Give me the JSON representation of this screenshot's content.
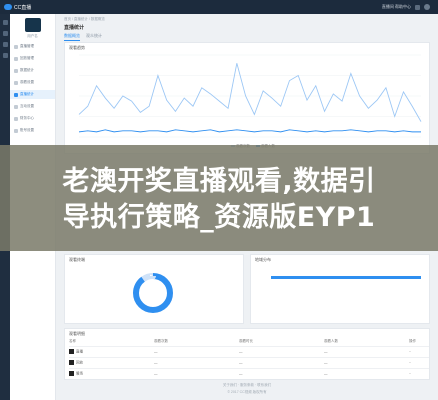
{
  "app": {
    "logo_text": "CC直播",
    "user_name": "用户名"
  },
  "topbar": {
    "right_text": "直播间 帮助中心"
  },
  "sidebar": {
    "items": [
      {
        "label": "直播管理",
        "active": false
      },
      {
        "label": "回放管理",
        "active": false
      },
      {
        "label": "数据统计",
        "active": false
      },
      {
        "label": "观看设置",
        "active": false
      },
      {
        "label": "直播统计",
        "active": true
      },
      {
        "label": "互动设置",
        "active": false
      },
      {
        "label": "财务中心",
        "active": false
      },
      {
        "label": "账号设置",
        "active": false
      }
    ]
  },
  "main": {
    "breadcrumb": "首页 / 直播统计 / 数据概览",
    "title": "直播统计",
    "tabs": [
      "数据概览",
      "观众统计"
    ],
    "trend_card_title": "观看趋势",
    "pie_card_title": "观看终端",
    "bar_card_title": "地域分布",
    "table_card_title": "观看明细",
    "table_headers": [
      "名称",
      "观看次数",
      "观看时长",
      "观看人数",
      "操作"
    ],
    "table_rows": [
      [
        "直播",
        "—",
        "—",
        "—",
        "··"
      ],
      [
        "回放",
        "—",
        "—",
        "—",
        "··"
      ],
      [
        "暖场",
        "—",
        "—",
        "—",
        "··"
      ]
    ],
    "legend": [
      "观看次数",
      "观看人数"
    ],
    "footer_line1": "关于我们 · 服务条款 · 联系我们",
    "footer_line2": "© 2017 CC视频 版权所有"
  },
  "banner": {
    "line1": "老澳开奖直播观看,数据引",
    "line2": "导执行策略_资源版EYP1"
  },
  "chart_data": {
    "type": "line",
    "x": [
      1,
      2,
      3,
      4,
      5,
      6,
      7,
      8,
      9,
      10,
      11,
      12,
      13,
      14,
      15,
      16,
      17,
      18,
      19,
      20,
      21,
      22,
      23,
      24,
      25,
      26,
      27,
      28,
      29,
      30,
      31,
      32,
      33,
      34,
      35,
      36,
      37,
      38,
      39,
      40
    ],
    "series": [
      {
        "values": [
          22,
          30,
          50,
          38,
          28,
          40,
          35,
          24,
          30,
          60,
          36,
          25,
          38,
          30,
          48,
          42,
          35,
          28,
          72,
          40,
          22,
          45,
          38,
          30,
          55,
          60,
          36,
          50,
          25,
          42,
          35,
          62,
          40,
          28,
          36,
          48,
          20,
          44,
          30,
          15
        ]
      },
      {
        "values": [
          5,
          6,
          5,
          7,
          5,
          6,
          6,
          5,
          6,
          6,
          5,
          7,
          6,
          5,
          6,
          7,
          5,
          6,
          7,
          6,
          5,
          6,
          6,
          5,
          7,
          6,
          5,
          6,
          5,
          6,
          6,
          7,
          6,
          5,
          6,
          6,
          5,
          6,
          5,
          5
        ]
      }
    ],
    "ylim": [
      0,
      80
    ],
    "grid": true,
    "legend_position": "bottom"
  },
  "pie_data": {
    "values": [
      90,
      10
    ]
  },
  "bar_data": {
    "values": [
      1
    ]
  },
  "colors": {
    "accent": "#2f8ff0",
    "accent_light": "#9cc7f5",
    "topbar": "#1c2b3d"
  }
}
